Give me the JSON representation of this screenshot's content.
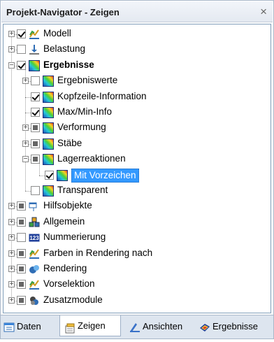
{
  "panel": {
    "title": "Projekt-Navigator - Zeigen",
    "close_glyph": "×"
  },
  "tree": {
    "items": [
      {
        "label": "Modell",
        "checkbox": "checked",
        "icon": "model-icon",
        "expander": "+"
      },
      {
        "label": "Belastung",
        "checkbox": "unchecked",
        "icon": "load-icon",
        "expander": "+"
      },
      {
        "label": "Ergebnisse",
        "checkbox": "checked",
        "icon": "results-icon",
        "expander": "-"
      },
      {
        "label": "Ergebniswerte",
        "checkbox": "unchecked",
        "icon": "results-icon",
        "expander": "+"
      },
      {
        "label": "Kopfzeile-Information",
        "checkbox": "checked",
        "icon": "results-icon"
      },
      {
        "label": "Max/Min-Info",
        "checkbox": "checked",
        "icon": "results-icon"
      },
      {
        "label": "Verformung",
        "checkbox": "partial",
        "icon": "results-icon",
        "expander": "+"
      },
      {
        "label": "Stäbe",
        "checkbox": "partial",
        "icon": "results-icon",
        "expander": "+"
      },
      {
        "label": "Lagerreaktionen",
        "checkbox": "partial",
        "icon": "results-icon",
        "expander": "-"
      },
      {
        "label": "Mit Vorzeichen",
        "checkbox": "checked",
        "icon": "results-icon",
        "selected": true
      },
      {
        "label": "Transparent",
        "checkbox": "unchecked",
        "icon": "results-icon"
      },
      {
        "label": "Hilfsobjekte",
        "checkbox": "partial",
        "icon": "guide-objects-icon",
        "expander": "+"
      },
      {
        "label": "Allgemein",
        "checkbox": "partial",
        "icon": "general-icon",
        "expander": "+"
      },
      {
        "label": "Nummerierung",
        "checkbox": "unchecked",
        "icon": "numbering-icon",
        "icon_text": "123",
        "expander": "+"
      },
      {
        "label": "Farben in Rendering nach",
        "checkbox": "partial",
        "icon": "model-icon",
        "expander": "+"
      },
      {
        "label": "Rendering",
        "checkbox": "partial",
        "icon": "rendering-icon",
        "expander": "+"
      },
      {
        "label": "Vorselektion",
        "checkbox": "partial",
        "icon": "model-icon",
        "expander": "+"
      },
      {
        "label": "Zusatzmodule",
        "checkbox": "partial",
        "icon": "addon-modules-icon",
        "expander": "+"
      }
    ]
  },
  "tabs": [
    {
      "label": "Daten",
      "icon": "data-tab-icon",
      "active": false
    },
    {
      "label": "Zeigen",
      "icon": "display-tab-icon",
      "active": true
    },
    {
      "label": "Ansichten",
      "icon": "views-tab-icon",
      "active": false
    },
    {
      "label": "Ergebnisse",
      "icon": "results-tab-icon",
      "active": false
    }
  ],
  "colors": {
    "selection": "#3399ff",
    "frame": "#a9b7c9",
    "tab_bar": "#dde5ef"
  }
}
